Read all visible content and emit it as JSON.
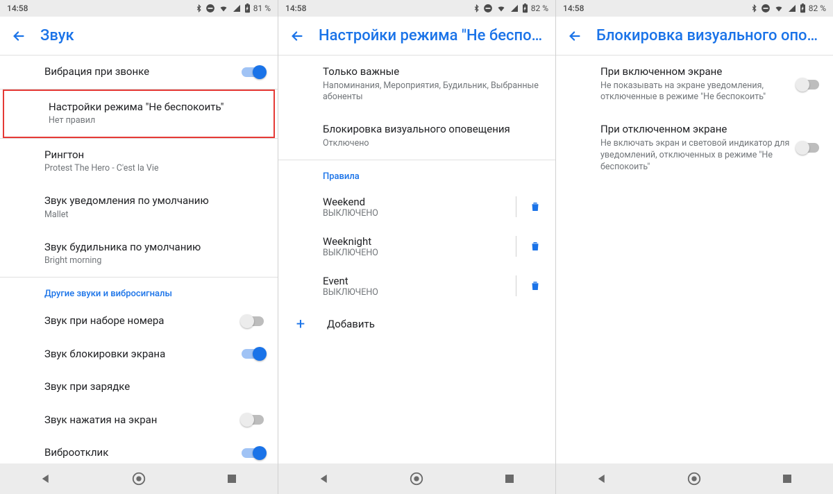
{
  "phones": [
    {
      "status": {
        "time": "14:58",
        "battery": "81 %"
      },
      "title": "Звук",
      "rows": [
        {
          "primary": "Вибрация при звонке",
          "switch": true,
          "on": true
        },
        {
          "primary": "Настройки режима \"Не беспокоить\"",
          "secondary": "Нет правил",
          "highlight": true
        },
        {
          "primary": "Рингтон",
          "secondary": "Protest The Hero - C'est la Vie"
        },
        {
          "primary": "Звук уведомления по умолчанию",
          "secondary": "Mallet"
        },
        {
          "primary": "Звук будильника по умолчанию",
          "secondary": "Bright morning"
        }
      ],
      "section": "Другие звуки и вибросигналы",
      "toggles": [
        {
          "primary": "Звук при наборе номера",
          "on": false
        },
        {
          "primary": "Звук блокировки экрана",
          "on": true
        },
        {
          "primary": "Звук при зарядке",
          "on": null
        },
        {
          "primary": "Звук нажатия на экран",
          "on": false
        },
        {
          "primary": "Виброотклик",
          "on": true
        }
      ]
    },
    {
      "status": {
        "time": "14:58",
        "battery": "82 %"
      },
      "title": "Настройки режима \"Не беспок…",
      "rows": [
        {
          "primary": "Только важные",
          "secondary": "Напоминания, Мероприятия, Будильник, Выбранные абоненты"
        },
        {
          "primary": "Блокировка визуального оповещения",
          "secondary": "Отключено"
        }
      ],
      "section": "Правила",
      "rules": [
        {
          "primary": "Weekend",
          "secondary": "ВЫКЛЮЧЕНО"
        },
        {
          "primary": "Weeknight",
          "secondary": "ВЫКЛЮЧЕНО"
        },
        {
          "primary": "Event",
          "secondary": "ВЫКЛЮЧЕНО"
        }
      ],
      "add": "Добавить"
    },
    {
      "status": {
        "time": "14:58",
        "battery": "82 %"
      },
      "title": "Блокировка визуального опов…",
      "rows": [
        {
          "primary": "При включенном экране",
          "secondary": "Не показывать на экране уведомления, отключенные в режиме \"Не беспокоить\"",
          "switch": true,
          "on": false
        },
        {
          "primary": "При отключенном экране",
          "secondary": "Не включать экран и световой индикатор для уведомлений, отключенных в режиме \"Не беспокоить\"",
          "switch": true,
          "on": false
        }
      ]
    }
  ]
}
